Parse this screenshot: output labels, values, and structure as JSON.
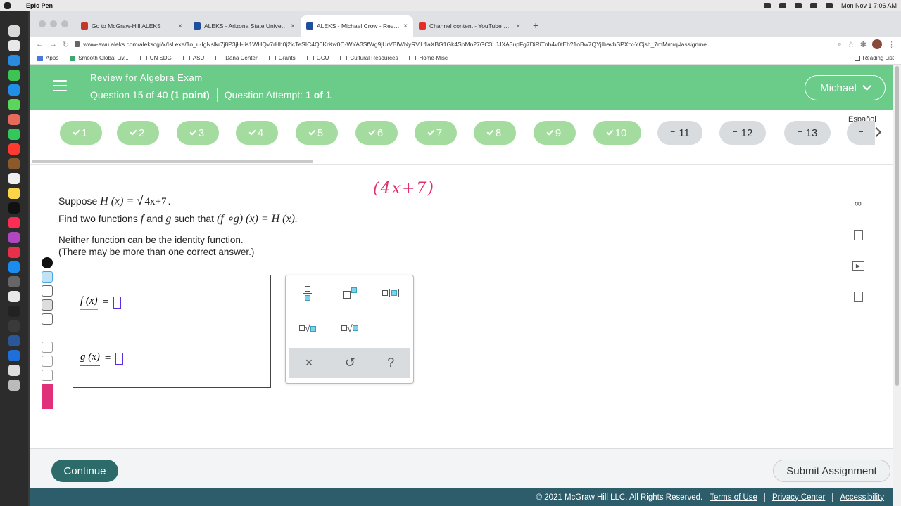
{
  "os": {
    "app_name": "Epic Pen",
    "clock": "Mon Nov 1  7:06 AM"
  },
  "browser": {
    "tabs": [
      {
        "title": "Go to McGraw-Hill ALEKS",
        "favicon_color": "#c0392b"
      },
      {
        "title": "ALEKS - Arizona State University",
        "favicon_color": "#1f4e9c"
      },
      {
        "title": "ALEKS - Michael Crow - Review",
        "favicon_color": "#1f4e9c"
      },
      {
        "title": "Channel content - YouTube Studio",
        "favicon_color": "#e52d27"
      }
    ],
    "url": "www-awu.aleks.com/alekscgi/x/Isl.exe/1o_u-IgNslkr7j8P3jH-lis1WHQv7rHh0j2icTeSIC4Q0KrKw0C-WYA3SfWg9jUrVBIWNyRViL1aXBG1Gk4SbMn27GC3LJJXA3upFg7DiRiTnh4v0tEh?1oBw7QYjIbavbSPXtx-YCjsh_7mMmrq#assignme...",
    "bookmarks": [
      "Apps",
      "Smooth Global Liv...",
      "UN SDG",
      "ASU",
      "Dana Center",
      "Grants",
      "GCU",
      "Cultural Resources",
      "Home-Misc"
    ],
    "reading_list": "Reading List"
  },
  "header": {
    "title": "Review for Algebra Exam",
    "question_label": "Question 15 of 40",
    "points": "(1 point)",
    "attempt_label": "Question Attempt:",
    "attempt_value": "1 of 1",
    "user": "Michael"
  },
  "question_nav": {
    "language": "Español",
    "items": [
      {
        "num": "1",
        "status": "done"
      },
      {
        "num": "2",
        "status": "done"
      },
      {
        "num": "3",
        "status": "done"
      },
      {
        "num": "4",
        "status": "done"
      },
      {
        "num": "5",
        "status": "done"
      },
      {
        "num": "6",
        "status": "done"
      },
      {
        "num": "7",
        "status": "done"
      },
      {
        "num": "8",
        "status": "done"
      },
      {
        "num": "9",
        "status": "done"
      },
      {
        "num": "10",
        "status": "done"
      },
      {
        "num": "11",
        "status": "todo"
      },
      {
        "num": "12",
        "status": "todo"
      },
      {
        "num": "13",
        "status": "todo"
      }
    ]
  },
  "question": {
    "line1_prefix": "Suppose",
    "func_H": "H (x) =",
    "radicand": "4x+7",
    "line1_end": ".",
    "line2_prefix": "Find two functions",
    "f": "f",
    "and": "and",
    "g": "g",
    "line2_mid": "such that",
    "composition": "(f ∘g) (x) = H (x).",
    "note1": "Neither function can be the identity function.",
    "note2": "(There may be more than one correct answer.)",
    "handwriting": "(4x+7)"
  },
  "answer": {
    "f_label": "f (x)",
    "g_label": "g (x)",
    "equals": "="
  },
  "keypad": {
    "clear": "×",
    "undo": "↺",
    "help": "?"
  },
  "footer": {
    "continue": "Continue",
    "submit": "Submit Assignment",
    "copyright": "© 2021 McGraw Hill LLC. All Rights Reserved.",
    "terms": "Terms of Use",
    "privacy": "Privacy Center",
    "accessibility": "Accessibility"
  },
  "colors": {
    "header_green": "#6bcc8a",
    "done_pill": "#a4dc9f",
    "continue_teal": "#2d6b6b",
    "ink_pink": "#e0306e",
    "ink_blue": "#4aa6e0"
  }
}
